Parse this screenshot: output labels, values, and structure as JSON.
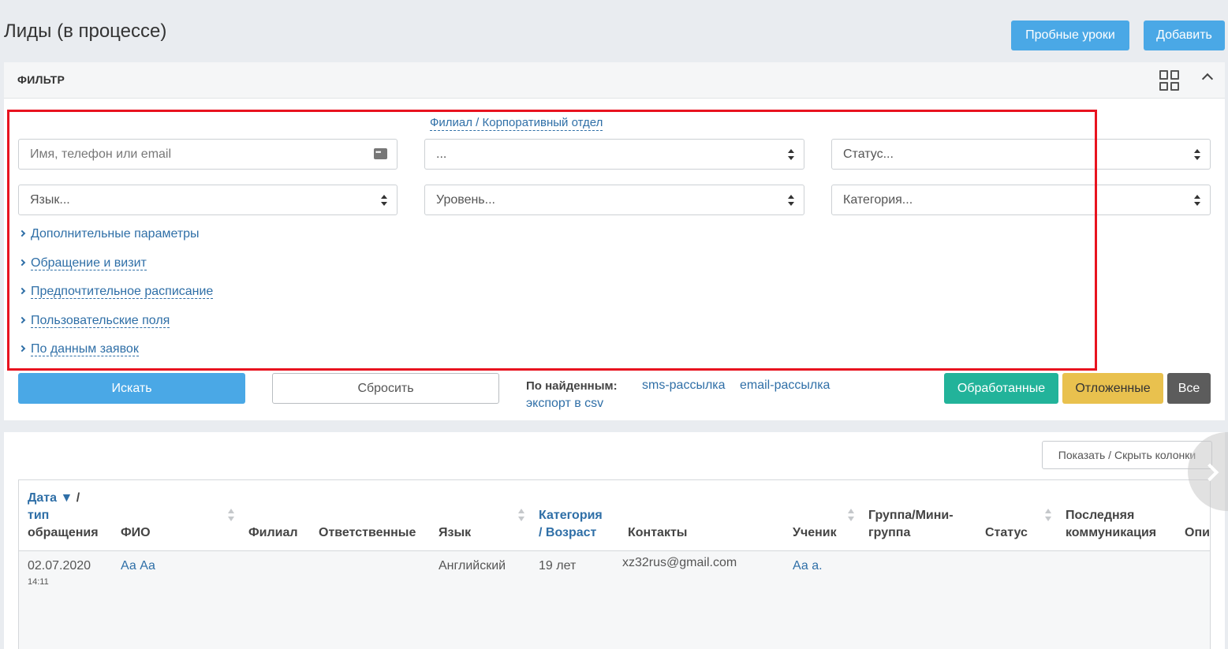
{
  "header": {
    "title": "Лиды (в процессе)",
    "trial_button": "Пробные уроки",
    "add_button": "Добавить"
  },
  "filter": {
    "title": "ФИЛЬТР",
    "branch_link": "Филиал / Корпоративный отдел",
    "search_placeholder": "Имя, телефон или email",
    "branch_select": "...",
    "status_select": "Статус...",
    "language_select": "Язык...",
    "level_select": "Уровень...",
    "category_select": "Категория...",
    "expanders": [
      "Дополнительные параметры",
      "Обращение и визит",
      "Предпочтительное расписание",
      "Пользовательские поля",
      "По данным заявок"
    ],
    "search_button": "Искать",
    "reset_button": "Сбросить",
    "found_label": "По найденным:",
    "sms_link": "sms-рассылка",
    "email_link": "email-рассылка",
    "csv_link": "экспорт в csv",
    "processed_button": "Обработанные",
    "deferred_button": "Отложенные",
    "all_button": "Все"
  },
  "table": {
    "columns_button": "Показать / Скрыть колонки",
    "headers": {
      "date_1": "Дата ▼",
      "date_slash": "/",
      "date_2": "тип",
      "date_3": "обращения",
      "fio": "ФИО",
      "branch": "Филиал",
      "responsible": "Ответственные",
      "language": "Язык",
      "category_1": "Категория",
      "category_2_prefix": "/ ",
      "category_2": "Возраст",
      "contacts": "Контакты",
      "student": "Ученик",
      "group_1": "Группа/Мини-",
      "group_2": "группа",
      "status": "Статус",
      "last_comm_1": "Последняя",
      "last_comm_2": "коммуникация",
      "desc": "Опи"
    },
    "rows": [
      {
        "date": "02.07.2020",
        "time": "14:11",
        "fio": "Аа Аа",
        "language": "Английский",
        "age": "19 лет",
        "contacts": "xz32rus@gmail.com",
        "student": "Аа а."
      }
    ]
  },
  "colors": {
    "primary": "#4aa8e6",
    "processed": "#22b39a",
    "deferred": "#e9c14e",
    "all": "#5c5c5c",
    "link": "#2f6fa7",
    "highlight_box": "#e8131f"
  }
}
